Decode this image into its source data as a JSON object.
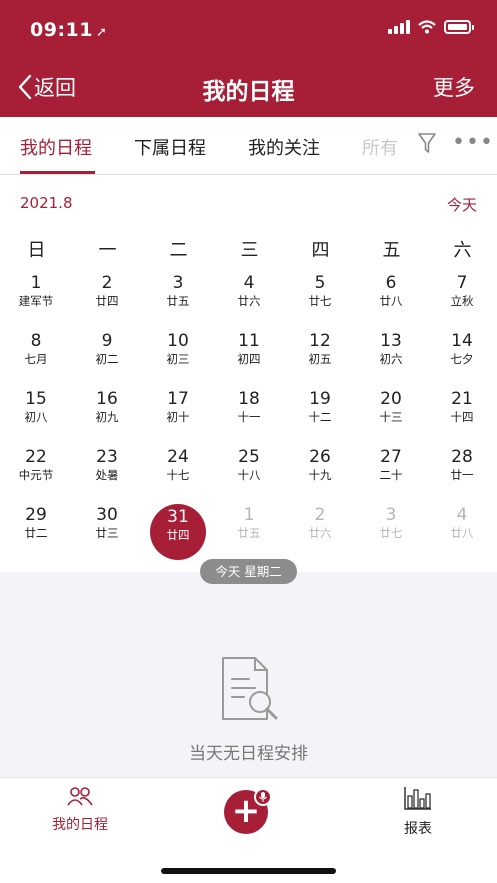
{
  "status_bar": {
    "time": "09:11"
  },
  "nav": {
    "back_label": "返回",
    "title": "我的日程",
    "more_label": "更多"
  },
  "tabs": [
    {
      "label": "我的日程",
      "active": true
    },
    {
      "label": "下属日程",
      "active": false
    },
    {
      "label": "我的关注",
      "active": false
    },
    {
      "label": "所有",
      "active": false
    }
  ],
  "calendar": {
    "month_label": "2021.8",
    "today_button": "今天",
    "weekdays": [
      "日",
      "一",
      "二",
      "三",
      "四",
      "五",
      "六"
    ],
    "weeks": [
      [
        {
          "day": "1",
          "lunar": "建军节"
        },
        {
          "day": "2",
          "lunar": "廿四"
        },
        {
          "day": "3",
          "lunar": "廿五"
        },
        {
          "day": "4",
          "lunar": "廿六"
        },
        {
          "day": "5",
          "lunar": "廿七"
        },
        {
          "day": "6",
          "lunar": "廿八"
        },
        {
          "day": "7",
          "lunar": "立秋"
        }
      ],
      [
        {
          "day": "8",
          "lunar": "七月"
        },
        {
          "day": "9",
          "lunar": "初二"
        },
        {
          "day": "10",
          "lunar": "初三"
        },
        {
          "day": "11",
          "lunar": "初四"
        },
        {
          "day": "12",
          "lunar": "初五"
        },
        {
          "day": "13",
          "lunar": "初六"
        },
        {
          "day": "14",
          "lunar": "七夕"
        }
      ],
      [
        {
          "day": "15",
          "lunar": "初八"
        },
        {
          "day": "16",
          "lunar": "初九"
        },
        {
          "day": "17",
          "lunar": "初十"
        },
        {
          "day": "18",
          "lunar": "十一"
        },
        {
          "day": "19",
          "lunar": "十二"
        },
        {
          "day": "20",
          "lunar": "十三"
        },
        {
          "day": "21",
          "lunar": "十四"
        }
      ],
      [
        {
          "day": "22",
          "lunar": "中元节"
        },
        {
          "day": "23",
          "lunar": "处暑"
        },
        {
          "day": "24",
          "lunar": "十七"
        },
        {
          "day": "25",
          "lunar": "十八"
        },
        {
          "day": "26",
          "lunar": "十九"
        },
        {
          "day": "27",
          "lunar": "二十"
        },
        {
          "day": "28",
          "lunar": "廿一"
        }
      ],
      [
        {
          "day": "29",
          "lunar": "廿二"
        },
        {
          "day": "30",
          "lunar": "廿三"
        },
        {
          "day": "31",
          "lunar": "廿四",
          "selected": true
        },
        {
          "day": "1",
          "lunar": "廿五",
          "muted": true
        },
        {
          "day": "2",
          "lunar": "廿六",
          "muted": true
        },
        {
          "day": "3",
          "lunar": "廿七",
          "muted": true
        },
        {
          "day": "4",
          "lunar": "廿八",
          "muted": true
        }
      ]
    ],
    "today_pill": "今天 星期二"
  },
  "empty_state": {
    "text": "当天无日程安排",
    "icon": "document-search-icon"
  },
  "bottom_bar": {
    "mine_label": "我的日程",
    "add_icon": "plus-icon",
    "report_label": "报表"
  },
  "colors": {
    "brand": "#a61f37",
    "panel": "#f3f4f8"
  }
}
